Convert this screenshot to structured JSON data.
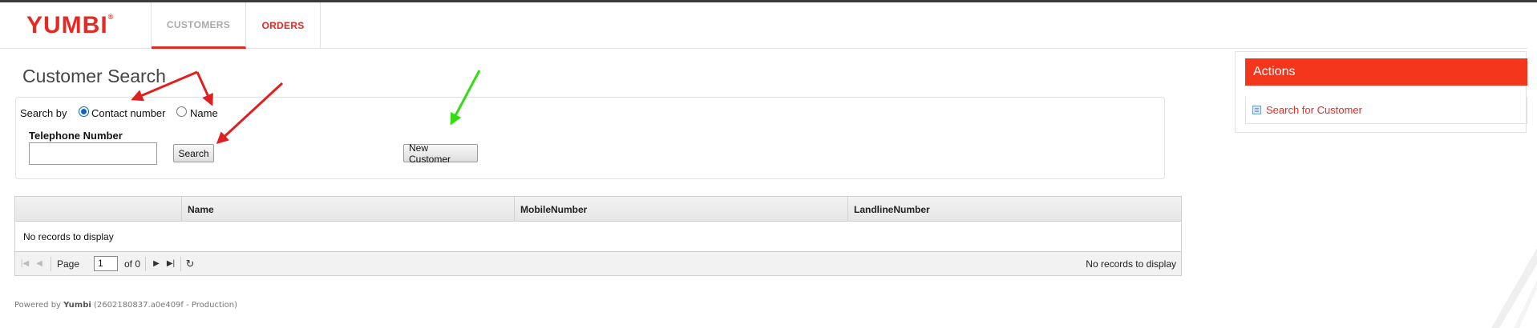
{
  "app": {
    "logo": "YUMBI",
    "logo_mark": "®"
  },
  "nav": {
    "tabs": [
      {
        "label": "CUSTOMERS"
      },
      {
        "label": "ORDERS"
      }
    ]
  },
  "page": {
    "title": "Customer Search"
  },
  "search": {
    "search_by_label": "Search by",
    "options": [
      {
        "label": "Contact number",
        "selected": true
      },
      {
        "label": "Name",
        "selected": false
      }
    ],
    "field_label": "Telephone Number",
    "field_value": "",
    "search_button": "Search",
    "new_customer_button": "New Customer"
  },
  "grid": {
    "columns": [
      "",
      "Name",
      "MobileNumber",
      "LandlineNumber"
    ],
    "empty_message": "No records to display",
    "pager": {
      "page_label": "Page",
      "page_value": "1",
      "of_label": "of 0",
      "status": "No records to display"
    }
  },
  "footer": {
    "prefix": "Powered by",
    "brand": "Yumbi",
    "version": "(2602180837.a0e409f - Production)"
  },
  "actions": {
    "title": "Actions",
    "items": [
      {
        "label": "Search for Customer",
        "icon": "list-icon"
      }
    ]
  },
  "colors": {
    "brand_red": "#e52a23",
    "actions_header": "#f3361c",
    "annotation_red": "#e02020",
    "annotation_green": "#33dd11"
  }
}
